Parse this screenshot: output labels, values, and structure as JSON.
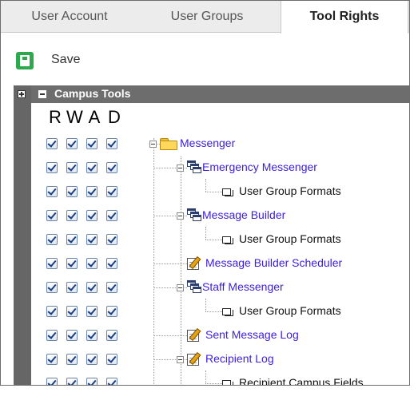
{
  "tabs": [
    {
      "label": "User Account",
      "active": false
    },
    {
      "label": "User Groups",
      "active": false
    },
    {
      "label": "Tool Rights",
      "active": true
    }
  ],
  "toolbar": {
    "save_label": "Save",
    "save_icon": "save-icon",
    "save_color": "#2ea84c"
  },
  "section": {
    "title": "Campus Tools",
    "header_color": "#6d6d6d"
  },
  "columns": [
    "R",
    "W",
    "A",
    "D"
  ],
  "tree": [
    {
      "label": "Messenger",
      "icon": "folder-icon",
      "link": true,
      "expandable": true,
      "rights": [
        true,
        true,
        true,
        true
      ]
    },
    {
      "label": "Emergency Messenger",
      "icon": "windows-icon",
      "link": true,
      "expandable": true,
      "rights": [
        true,
        true,
        true,
        true
      ]
    },
    {
      "label": "User Group Formats",
      "icon": "page-icon",
      "link": false,
      "expandable": false,
      "rights": [
        true,
        true,
        true,
        true
      ]
    },
    {
      "label": "Message Builder",
      "icon": "windows-icon",
      "link": true,
      "expandable": true,
      "rights": [
        true,
        true,
        true,
        true
      ]
    },
    {
      "label": "User Group Formats",
      "icon": "page-icon",
      "link": false,
      "expandable": false,
      "rights": [
        true,
        true,
        true,
        true
      ]
    },
    {
      "label": "Message Builder Scheduler",
      "icon": "pencil-icon",
      "link": true,
      "expandable": false,
      "rights": [
        true,
        true,
        true,
        true
      ]
    },
    {
      "label": "Staff Messenger",
      "icon": "windows-icon",
      "link": true,
      "expandable": true,
      "rights": [
        true,
        true,
        true,
        true
      ]
    },
    {
      "label": "User Group Formats",
      "icon": "page-icon",
      "link": false,
      "expandable": false,
      "rights": [
        true,
        true,
        true,
        true
      ]
    },
    {
      "label": "Sent Message Log",
      "icon": "pencil-icon",
      "link": true,
      "expandable": false,
      "rights": [
        true,
        true,
        true,
        true
      ]
    },
    {
      "label": "Recipient Log",
      "icon": "pencil-icon",
      "link": true,
      "expandable": true,
      "rights": [
        true,
        true,
        true,
        true
      ]
    },
    {
      "label": "Recipient Campus Fields",
      "icon": "page-icon",
      "link": false,
      "expandable": false,
      "rights": [
        true,
        true,
        true,
        true
      ]
    }
  ],
  "colors": {
    "link": "#3b1fd8",
    "checkbox_border": "#6a84a9",
    "check": "#1c3f84"
  }
}
